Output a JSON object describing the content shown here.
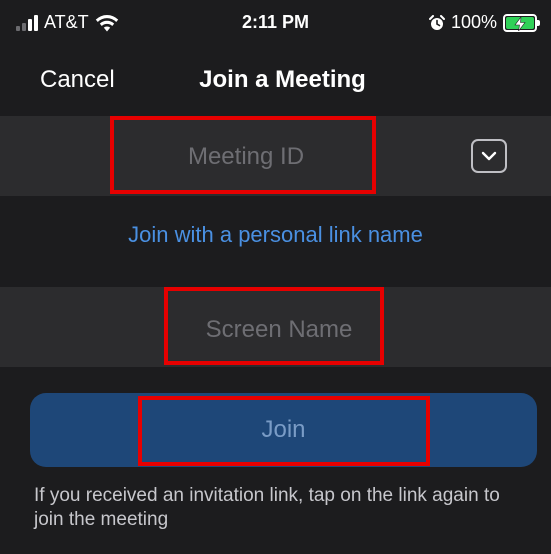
{
  "status_bar": {
    "carrier": "AT&T",
    "time": "2:11 PM",
    "battery_percent": "100%",
    "signal_bars_active": 2,
    "signal_bars_total": 4,
    "battery_level": 1.0,
    "charging": true,
    "battery_color": "#30d158",
    "icons": [
      "signal-icon",
      "wifi-icon",
      "alarm-icon",
      "battery-icon"
    ]
  },
  "nav": {
    "cancel_label": "Cancel",
    "title": "Join a Meeting"
  },
  "meeting_id": {
    "placeholder": "Meeting ID",
    "value": "",
    "dropdown_icon": "chevron-down-icon"
  },
  "personal_link": {
    "label": "Join with a personal link name",
    "color": "#4a90e2"
  },
  "screen_name": {
    "placeholder": "Screen Name",
    "value": ""
  },
  "join": {
    "label": "Join",
    "color": "#1e4778"
  },
  "help_text": "If you received an invitation link, tap on the link again to join the meeting",
  "highlight_color": "#e60000"
}
